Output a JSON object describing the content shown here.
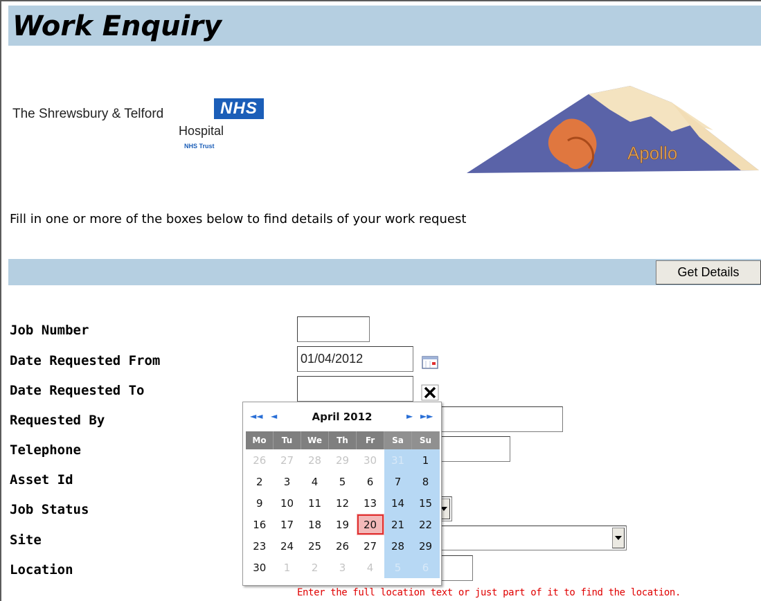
{
  "header": {
    "title": "Work Enquiry"
  },
  "branding": {
    "trust_line1": "The Shrewsbury & Telford",
    "nhs_badge": "NHS",
    "trust_line2": "Hospital",
    "trust_line3": "NHS Trust",
    "apollo_label": "Apollo",
    "nhs_blue": "#1b5eb8"
  },
  "instructions": "Fill in one or more of the boxes below to find details of your work request",
  "actions": {
    "get_details": "Get Details"
  },
  "form": {
    "job_number": {
      "label": "Job Number",
      "value": ""
    },
    "date_from": {
      "label": "Date Requested From",
      "value": "01/04/2012"
    },
    "date_to": {
      "label": "Date Requested To",
      "value": ""
    },
    "requested_by": {
      "label": "Requested By",
      "value": ""
    },
    "telephone": {
      "label": "Telephone",
      "value": ""
    },
    "asset_id": {
      "label": "Asset Id",
      "value": ""
    },
    "job_status": {
      "label": "Job Status",
      "value": ""
    },
    "site": {
      "label": "Site",
      "value": ""
    },
    "location": {
      "label": "Location",
      "value": "",
      "hint": "Enter the full location text or just part of it to find the location."
    }
  },
  "icons": {
    "calendar": "calendar-icon",
    "clear": "close-icon",
    "dropdown": "chevron-down-icon"
  },
  "calendar": {
    "title": "April 2012",
    "nav": {
      "prev_year": "◄◄",
      "prev_month": "◄",
      "next_month": "►",
      "next_year": "►►"
    },
    "weekdays": [
      "Mo",
      "Tu",
      "We",
      "Th",
      "Fr",
      "Sa",
      "Su"
    ],
    "weeks": [
      [
        {
          "d": "26",
          "o": true
        },
        {
          "d": "27",
          "o": true
        },
        {
          "d": "28",
          "o": true
        },
        {
          "d": "29",
          "o": true
        },
        {
          "d": "30",
          "o": true
        },
        {
          "d": "31",
          "o": true
        },
        {
          "d": "1"
        }
      ],
      [
        {
          "d": "2"
        },
        {
          "d": "3"
        },
        {
          "d": "4"
        },
        {
          "d": "5"
        },
        {
          "d": "6"
        },
        {
          "d": "7"
        },
        {
          "d": "8"
        }
      ],
      [
        {
          "d": "9"
        },
        {
          "d": "10"
        },
        {
          "d": "11"
        },
        {
          "d": "12"
        },
        {
          "d": "13"
        },
        {
          "d": "14"
        },
        {
          "d": "15"
        }
      ],
      [
        {
          "d": "16"
        },
        {
          "d": "17"
        },
        {
          "d": "18"
        },
        {
          "d": "19"
        },
        {
          "d": "20",
          "today": true
        },
        {
          "d": "21"
        },
        {
          "d": "22"
        }
      ],
      [
        {
          "d": "23"
        },
        {
          "d": "24"
        },
        {
          "d": "25"
        },
        {
          "d": "26"
        },
        {
          "d": "27"
        },
        {
          "d": "28"
        },
        {
          "d": "29"
        }
      ],
      [
        {
          "d": "30"
        },
        {
          "d": "1",
          "o": true
        },
        {
          "d": "2",
          "o": true
        },
        {
          "d": "3",
          "o": true
        },
        {
          "d": "4",
          "o": true
        },
        {
          "d": "5",
          "o": true
        },
        {
          "d": "6",
          "o": true
        }
      ]
    ],
    "colors": {
      "weekend": "#b7d8f4",
      "header": "#7f7f7f",
      "today": "#f3b9b9",
      "today_border": "#e03030"
    }
  }
}
